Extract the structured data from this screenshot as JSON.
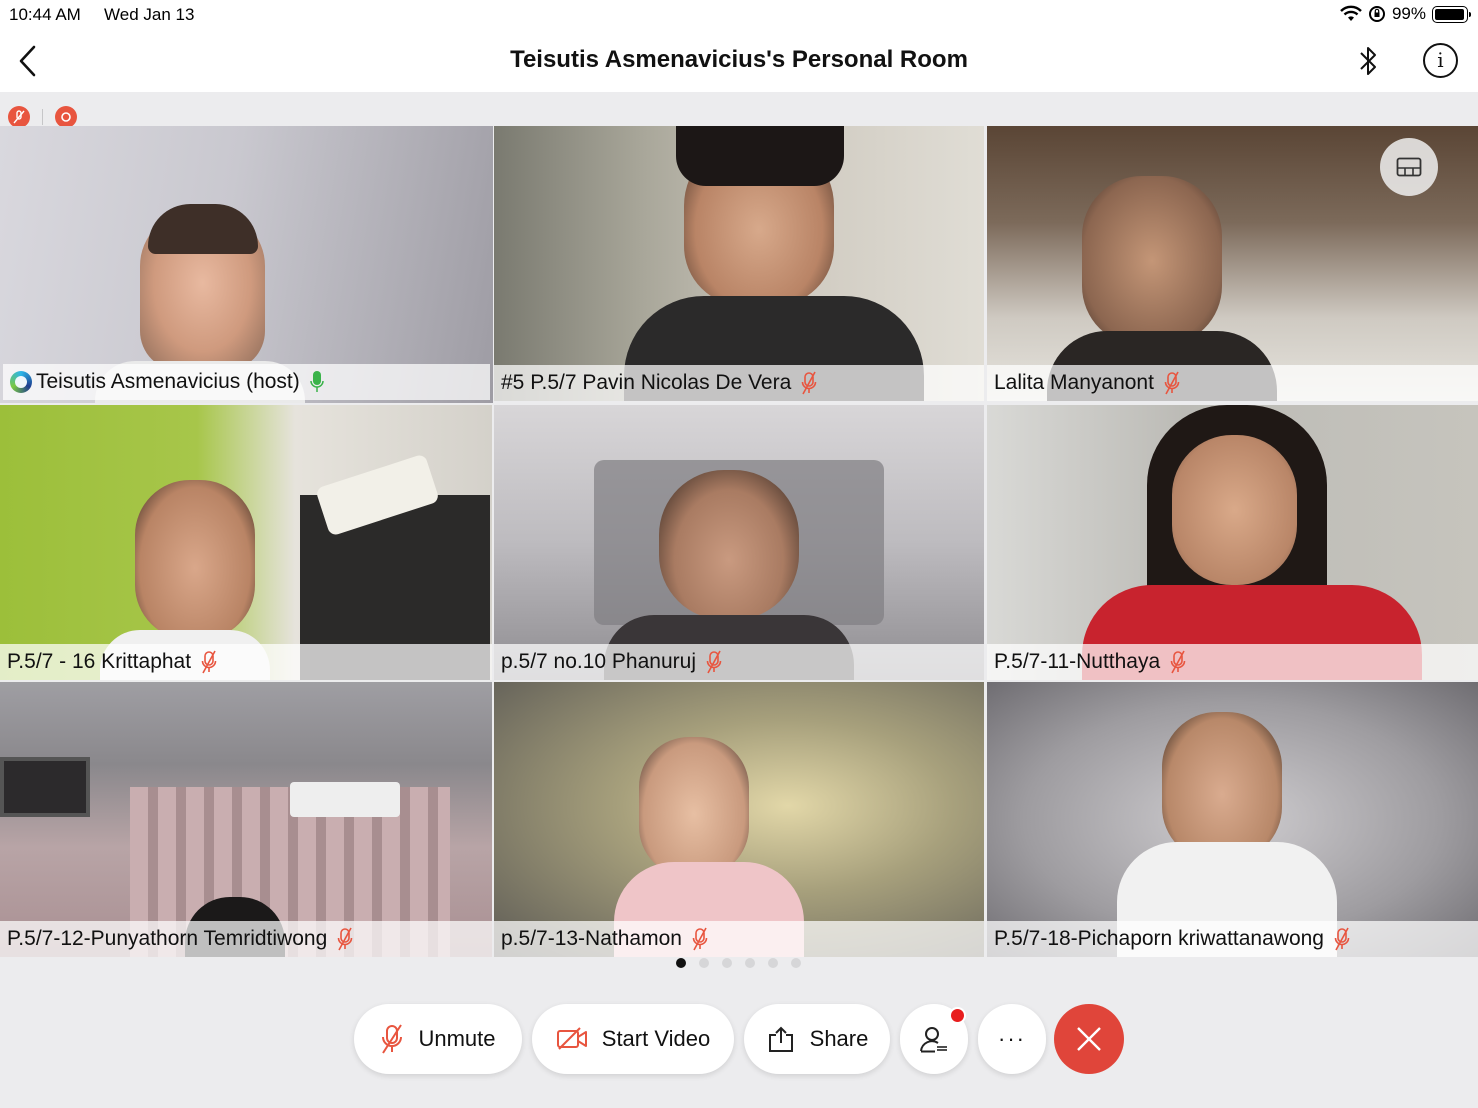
{
  "status_bar": {
    "time": "10:44 AM",
    "date": "Wed Jan 13",
    "battery": "99%"
  },
  "header": {
    "title": "Teisutis Asmenavicius's Personal Room"
  },
  "participants": [
    {
      "name": "Teisutis Asmenavicius (host)",
      "muted": false,
      "host": true
    },
    {
      "name": "#5 P.5/7 Pavin Nicolas De Vera",
      "muted": true
    },
    {
      "name": "Lalita Manyanont",
      "muted": true
    },
    {
      "name": "P.5/7 - 16 Krittaphat",
      "muted": true
    },
    {
      "name": "p.5/7 no.10 Phanuruj",
      "muted": true
    },
    {
      "name": "P.5/7-11-Nutthaya",
      "muted": true
    },
    {
      "name": "P.5/7-12-Punyathorn Temridtiwong",
      "muted": true
    },
    {
      "name": "p.5/7-13-Nathamon",
      "muted": true
    },
    {
      "name": "P.5/7-18-Pichaporn kriwattanawong",
      "muted": true
    }
  ],
  "pagination": {
    "total_pages": 6,
    "current_page": 1
  },
  "toolbar": {
    "unmute_label": "Unmute",
    "start_video_label": "Start Video",
    "share_label": "Share",
    "more_label": "···"
  },
  "colors": {
    "accent": "#2a7bbf",
    "danger": "#e0453a",
    "muted_icon": "#e8553f",
    "host_mic": "#3bb34a"
  }
}
